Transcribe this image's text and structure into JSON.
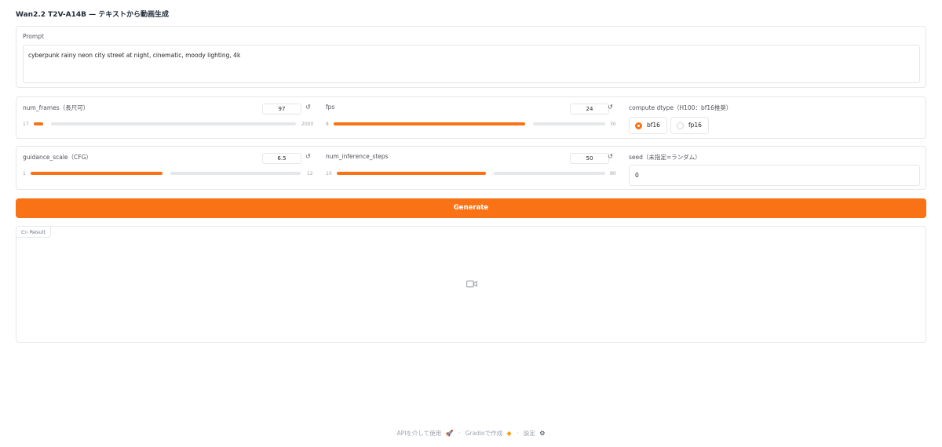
{
  "app": {
    "title": "Wan2.2 T2V-A14B — テキストから動画生成"
  },
  "prompt": {
    "label": "Prompt",
    "value": "cyberpunk rainy neon city street at night, cinematic, moody lighting, 4k"
  },
  "controls": {
    "num_frames": {
      "label": "num_frames（長尺可）",
      "value": "97",
      "min": "17",
      "max": "2000",
      "fraction": 0.04
    },
    "fps": {
      "label": "fps",
      "value": "24",
      "min": "8",
      "max": "30",
      "fraction": 0.73
    },
    "compute_dtype": {
      "label": "compute dtype（H100：bf16推奨）",
      "options": [
        "bf16",
        "fp16"
      ],
      "selected": "bf16"
    },
    "guidance_scale": {
      "label": "guidance_scale（CFG）",
      "value": "6.5",
      "min": "1",
      "max": "12",
      "fraction": 0.5
    },
    "num_inference_steps": {
      "label": "num_inference_steps",
      "value": "50",
      "min": "10",
      "max": "80",
      "fraction": 0.57
    },
    "seed": {
      "label": "seed（未指定=ランダム）",
      "value": "0"
    }
  },
  "generate": {
    "label": "Generate"
  },
  "result": {
    "label": "Result",
    "icon": "video-icon"
  },
  "footer": {
    "api": "APIを介して使用",
    "gradio": "Gradioで作成",
    "settings": "設定"
  },
  "colors": {
    "accent": "#f97316",
    "border": "#e5e7eb",
    "muted": "#9ca3af"
  }
}
